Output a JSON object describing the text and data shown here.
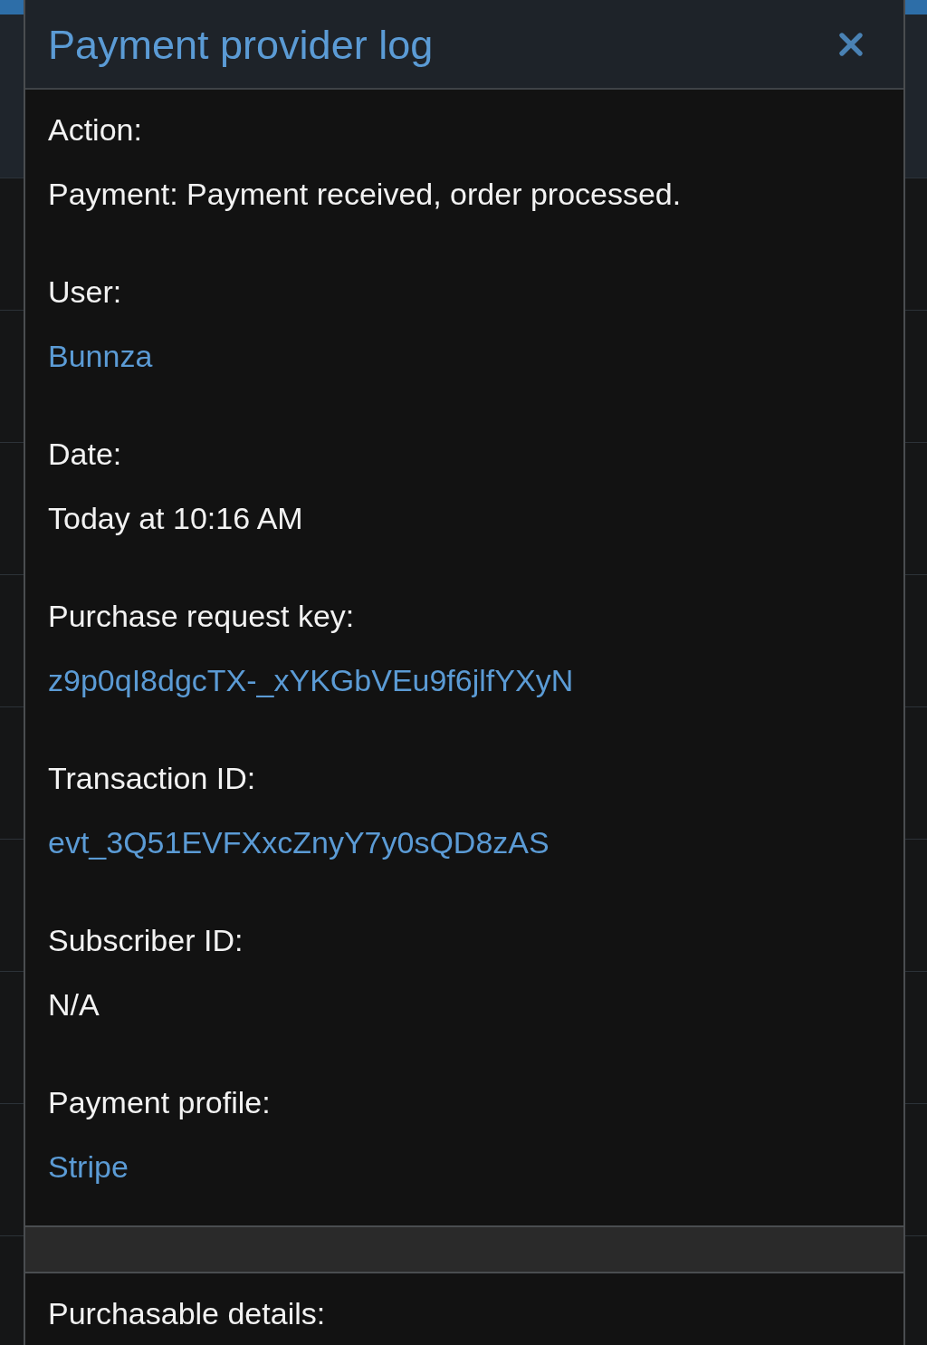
{
  "dialog": {
    "title": "Payment provider log",
    "fields": [
      {
        "label": "Action:",
        "value": "Payment: Payment received, order processed.",
        "kind": "text"
      },
      {
        "label": "User:",
        "value": "Bunnza",
        "kind": "link"
      },
      {
        "label": "Date:",
        "value": "Today at 10:16 AM",
        "kind": "text"
      },
      {
        "label": "Purchase request key:",
        "value": "z9p0qI8dgcTX-_xYKGbVEu9f6jlfYXyN",
        "kind": "link"
      },
      {
        "label": "Transaction ID:",
        "value": "evt_3Q51EVFXxcZnyY7y0sQD8zAS",
        "kind": "link"
      },
      {
        "label": "Subscriber ID:",
        "value": "N/A",
        "kind": "text"
      },
      {
        "label": "Payment profile:",
        "value": "Stripe",
        "kind": "link"
      }
    ],
    "next_section": {
      "label": "Purchasable details:"
    }
  }
}
